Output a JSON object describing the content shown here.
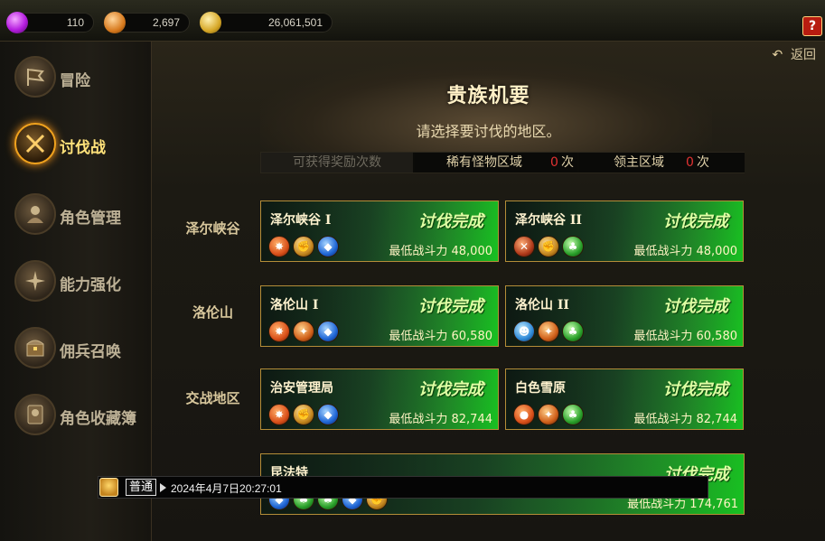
{
  "resources": [
    {
      "name": "gem-icon",
      "value": "110"
    },
    {
      "name": "coin-icon",
      "value": "2,697"
    },
    {
      "name": "gold-icon",
      "value": "26,061,501"
    }
  ],
  "help_label": "?",
  "sidebar": {
    "items": [
      {
        "label": "冒险",
        "icon": "flag-icon",
        "active": false
      },
      {
        "label": "讨伐战",
        "icon": "crossed-swords-icon",
        "active": true
      },
      {
        "label": "角色管理",
        "icon": "character-icon",
        "active": false
      },
      {
        "label": "能力强化",
        "icon": "shuriken-icon",
        "active": false
      },
      {
        "label": "佣兵召唤",
        "icon": "chest-icon",
        "active": false
      },
      {
        "label": "角色收藏簿",
        "icon": "book-icon",
        "active": false
      }
    ]
  },
  "main": {
    "back_label": "返回",
    "title": "贵族机要",
    "subtitle": "请选择要讨伐的地区。",
    "stats": {
      "rewards_label": "可获得奖励次数",
      "rare_label": "稀有怪物区域",
      "rare_count": "0",
      "boss_label": "领主区域",
      "boss_count": "0",
      "unit": "次"
    },
    "regions": [
      {
        "label": "泽尔峡谷"
      },
      {
        "label": "洛伦山"
      },
      {
        "label": "交战地区"
      }
    ],
    "cards": [
      {
        "name": "泽尔峡谷 I",
        "status": "讨伐完成",
        "power": "最低战斗力 48,000",
        "icons": [
          "fire-emblem-icon",
          "fist-icon",
          "water-icon"
        ]
      },
      {
        "name": "泽尔峡谷 II",
        "status": "讨伐完成",
        "power": "最低战斗力 48,000",
        "icons": [
          "crossed-swords-icon",
          "fist-icon",
          "clover-icon"
        ]
      },
      {
        "name": "洛伦山 I",
        "status": "讨伐完成",
        "power": "最低战斗力 60,580",
        "icons": [
          "fire-emblem-icon",
          "torch-icon",
          "water-icon"
        ]
      },
      {
        "name": "洛伦山 II",
        "status": "讨伐完成",
        "power": "最低战斗力 60,580",
        "icons": [
          "mask-icon",
          "torch-icon",
          "clover-icon"
        ]
      },
      {
        "name": "治安管理局",
        "status": "讨伐完成",
        "power": "最低战斗力 82,744",
        "icons": [
          "fire-emblem-icon",
          "fist-icon",
          "water-icon"
        ]
      },
      {
        "name": "白色雪原",
        "status": "讨伐完成",
        "power": "最低战斗力 82,744",
        "icons": [
          "fire-emblem-icon",
          "torch-icon",
          "clover-icon"
        ]
      },
      {
        "name": "昆法特",
        "status": "讨伐完成",
        "power": "最低战斗力 174,761",
        "icons": [
          "water-icon",
          "clover-icon",
          "clover-icon",
          "water-icon",
          "fist-icon"
        ]
      }
    ]
  },
  "chat": {
    "channel": "普通",
    "timestamp": "2024年4月7日20:27:01"
  }
}
